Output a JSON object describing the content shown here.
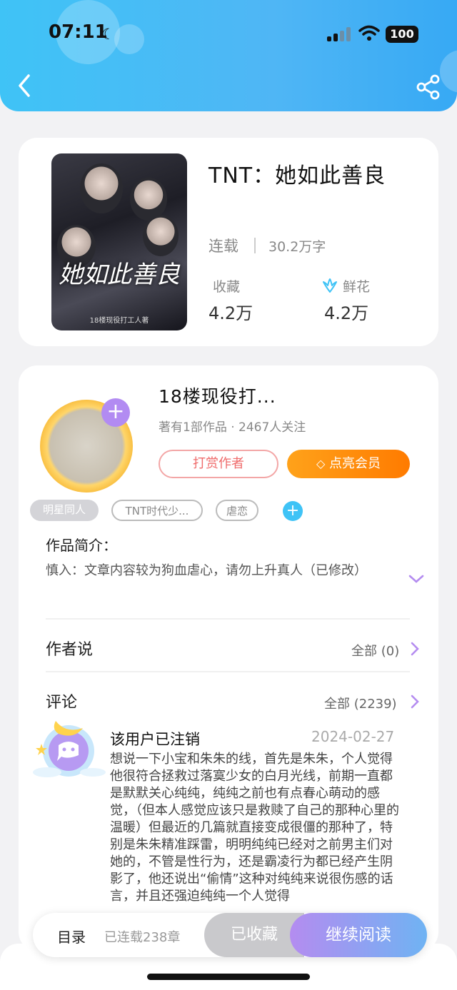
{
  "status_bar": {
    "time": "07:11",
    "battery": "100"
  },
  "book": {
    "title": "TNT：她如此善良",
    "cover_title": "她如此善良",
    "cover_subtitle": "18楼现役打工人著",
    "status": "连载",
    "word_count": "30.2万字",
    "favorites_label": "收藏",
    "favorites_value": "4.2万",
    "flowers_label": "鲜花",
    "flowers_value": "4.2万"
  },
  "author": {
    "name": "18楼现役打...",
    "meta": "著有1部作品 · 2467人关注",
    "tip_label": "打赏作者",
    "vip_label": "点亮会员"
  },
  "tags": [
    "明星同人",
    "TNT时代少...",
    "虐恋"
  ],
  "intro": {
    "title": "作品简介：",
    "text": "慎入：文章内容较为狗血虐心，请勿上升真人（已修改）"
  },
  "author_says": {
    "title": "作者说",
    "more": "全部 (0)"
  },
  "comments": {
    "title": "评论",
    "more": "全部 (2239)",
    "items": [
      {
        "user": "该用户已注销",
        "date": "2024-02-27",
        "text": "想说一下小宝和朱朱的线，首先是朱朱，个人觉得他很符合拯救过落寞少女的白月光线，前期一直都是默默关心纯纯，纯纯之前也有点春心萌动的感觉，（但本人感觉应该只是救赎了自己的那种心里的温暖）但最近的几篇就直接变成很僵的那种了，特别是朱朱精准踩雷，明明纯纯已经对之前男主们对她的，不管是性行为，还是霸凌行为都已经产生阴影了，他还说出“偷情”这种对纯纯来说很伤感的话言，并且还强迫纯纯一个人觉得"
      }
    ]
  },
  "bottom_bar": {
    "menu_label": "目录",
    "chapters": "已连载238章",
    "collected_label": "已收藏",
    "continue_label": "继续阅读"
  },
  "colors": {
    "header": "#3fc3f6",
    "vip": "#ff8a00",
    "continue_start": "#b48cf0",
    "continue_end": "#6fb3f3"
  }
}
